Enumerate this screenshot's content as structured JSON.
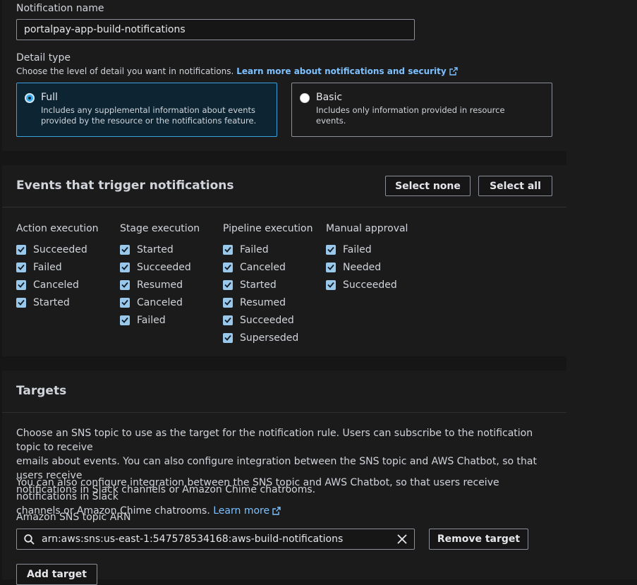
{
  "notification": {
    "name_label": "Notification name",
    "name_value": "portalpay-app-build-notifications"
  },
  "detail": {
    "label": "Detail type",
    "help_text": "Choose the level of detail you want in notifications.",
    "help_link": "Learn more about notifications and security",
    "options": [
      {
        "title": "Full",
        "line1": "Includes any supplemental information about events",
        "line2": "provided by the resource or the notifications feature.",
        "selected": true
      },
      {
        "title": "Basic",
        "line1": "Includes only information provided in resource events.",
        "line2": "",
        "selected": false
      }
    ]
  },
  "events": {
    "title": "Events that trigger notifications",
    "select_none": "Select none",
    "select_all": "Select all",
    "columns": [
      {
        "heading": "Action execution",
        "items": [
          "Succeeded",
          "Failed",
          "Canceled",
          "Started"
        ]
      },
      {
        "heading": "Stage execution",
        "items": [
          "Started",
          "Succeeded",
          "Resumed",
          "Canceled",
          "Failed"
        ]
      },
      {
        "heading": "Pipeline execution",
        "items": [
          "Failed",
          "Canceled",
          "Started",
          "Resumed",
          "Succeeded",
          "Superseded"
        ]
      },
      {
        "heading": "Manual approval",
        "items": [
          "Failed",
          "Needed",
          "Succeeded"
        ]
      }
    ]
  },
  "targets": {
    "title": "Targets",
    "para1_line1": "Choose an SNS topic to use as the target for the notification rule. Users can subscribe to the notification topic to receive",
    "para1_line2": "emails about events. You can also configure integration between the SNS topic and AWS Chatbot, so that users receive",
    "para1_line3": "notifications in Slack channels or Amazon Chime chatrooms.",
    "para2_line1": "You can also configure integration between the SNS topic and AWS Chatbot, so that users receive notifications in Slack",
    "para2_line2": "channels or Amazon Chime chatrooms.",
    "learn_more": "Learn more",
    "arn_label": "Amazon SNS topic ARN",
    "arn_value": "arn:aws:sns:us-east-1:547578534168:aws-build-notifications",
    "remove_target": "Remove target",
    "add_target": "Add target"
  },
  "colors": {
    "accent": "#39a8e8",
    "link": "#7cc0ff",
    "checkbox": "#9ac8ea"
  }
}
